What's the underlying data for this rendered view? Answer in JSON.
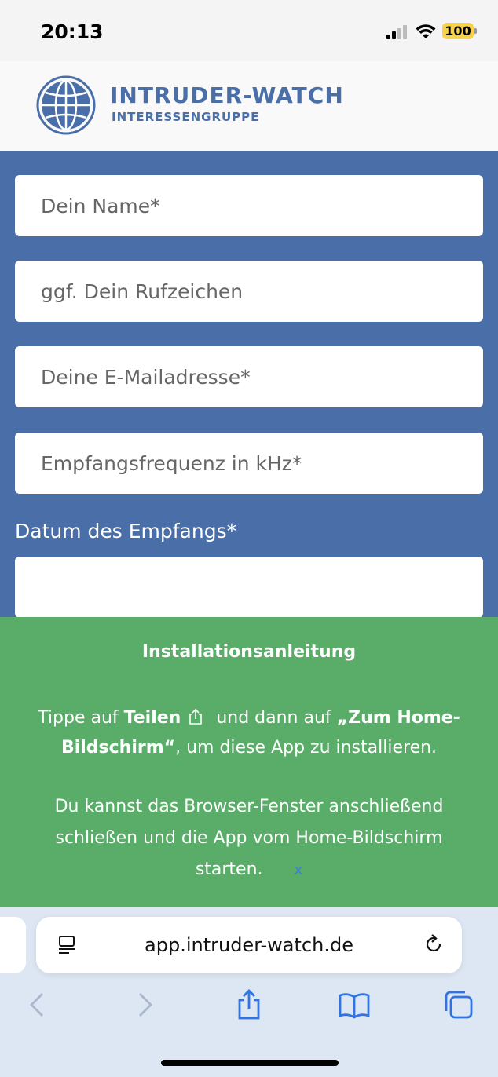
{
  "status_bar": {
    "time": "20:13",
    "battery": "100"
  },
  "header": {
    "title": "INTRUDER-WATCH",
    "subtitle": "INTERESSENGRUPPE"
  },
  "form": {
    "name_placeholder": "Dein Name*",
    "callsign_placeholder": "ggf. Dein Rufzeichen",
    "email_placeholder": "Deine E-Mailadresse*",
    "frequency_placeholder": "Empfangsfrequenz in kHz*",
    "date_label": "Datum des Empfangs*",
    "date_value": ""
  },
  "install_banner": {
    "title": "Installationsanleitung",
    "p1_prefix": "Tippe auf ",
    "p1_share": "Teilen",
    "p1_middle": " und dann auf ",
    "p1_home": "„Zum Home-Bildschirm“",
    "p1_suffix": ", um diese App zu installieren.",
    "p2": "Du kannst das Browser-Fenster anschließend schließen und die App vom Home-Bildschirm starten.",
    "close": "x"
  },
  "browser": {
    "url": "app.intruder-watch.de"
  },
  "colors": {
    "brand_blue": "#4a6fa8",
    "banner_green": "#59ad69",
    "link_blue": "#3c7be0"
  }
}
